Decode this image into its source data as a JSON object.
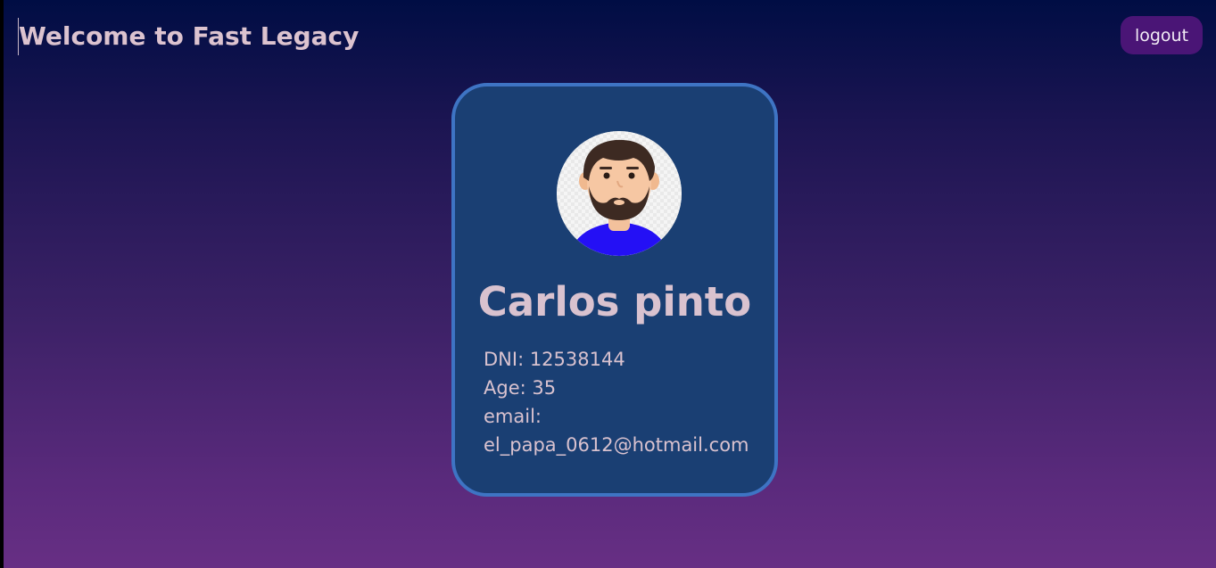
{
  "header": {
    "title": "Welcome to Fast Legacy",
    "logout_label": "logout"
  },
  "profile": {
    "avatar_icon": "male-avatar-icon",
    "name": "Carlos pinto",
    "dni_line": "DNI: 12538144",
    "age_line": "Age: 35",
    "email_label": "email:",
    "email_value": "el_papa_0612@hotmail.com"
  },
  "colors": {
    "background_top": "#000d44",
    "background_bottom": "#672f84",
    "card_background": "#1a3f73",
    "card_border": "#3e74c4",
    "logout_button": "#4a1576",
    "text": "#d9c2cf"
  }
}
